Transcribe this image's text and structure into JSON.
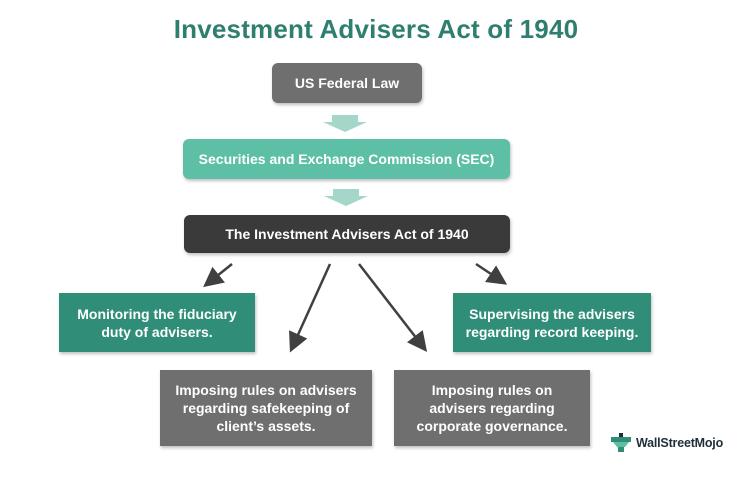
{
  "title": "Investment Advisers Act of 1940",
  "nodes": {
    "federal_law": "US Federal Law",
    "sec": "Securities and Exchange Commission (SEC)",
    "act": "The Investment Advisers Act of 1940",
    "fiduciary": "Monitoring the fiduciary duty of advisers.",
    "record_keeping": "Supervising the advisers regarding record keeping.",
    "safekeeping": "Imposing rules on advisers regarding safekeeping of client’s assets.",
    "governance": "Imposing rules on advisers regarding corporate governance."
  },
  "logo": {
    "text": "WallStreetMojo",
    "icon": "wallstreetmojo-logo-icon"
  },
  "colors": {
    "title": "#2f7f70",
    "gray_box": "#6f6f6f",
    "dark_box": "#3a3a3a",
    "mint_box": "#5dbfa5",
    "teal_box": "#2f8d78",
    "down_arrow": "#a5d6ca",
    "diagonal_arrow": "#404040"
  }
}
